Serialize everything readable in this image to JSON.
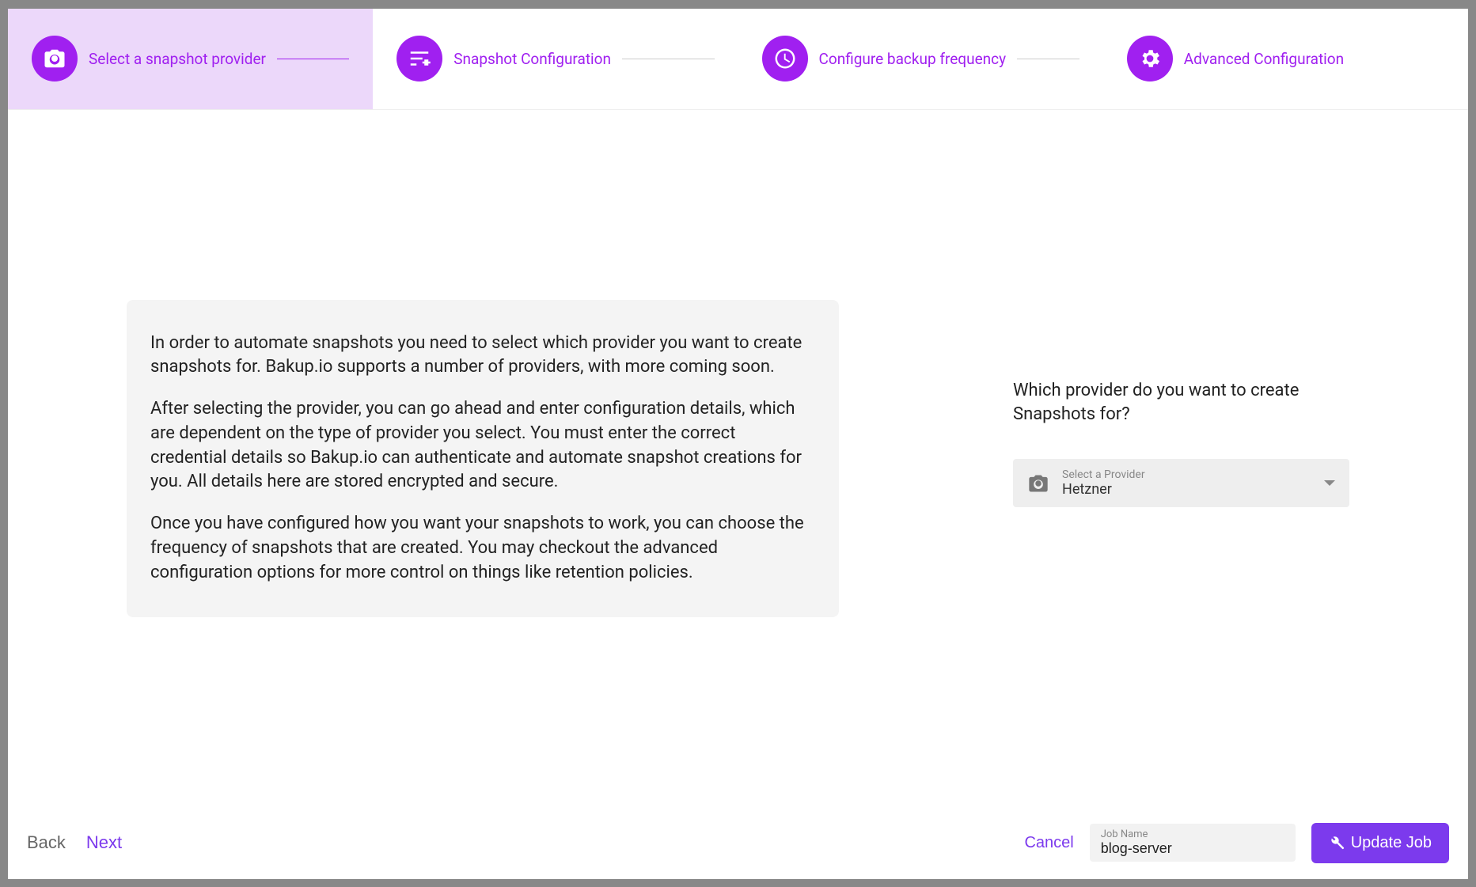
{
  "stepper": {
    "steps": [
      {
        "label": "Select a snapshot provider"
      },
      {
        "label": "Snapshot Configuration"
      },
      {
        "label": "Configure backup frequency"
      },
      {
        "label": "Advanced Configuration"
      }
    ]
  },
  "info": {
    "p1": "In order to automate snapshots you need to select which provider you want to create snapshots for. Bakup.io supports a number of providers, with more coming soon.",
    "p2": "After selecting the provider, you can go ahead and enter configuration details, which are dependent on the type of provider you select. You must enter the correct credential details so Bakup.io can authenticate and automate snapshot creations for you. All details here are stored encrypted and secure.",
    "p3": "Once you have configured how you want your snapshots to work, you can choose the frequency of snapshots that are created. You may checkout the advanced configuration options for more control on things like retention policies."
  },
  "providerSelect": {
    "question": "Which provider do you want to create Snapshots for?",
    "placeholder": "Select a Provider",
    "value": "Hetzner"
  },
  "footer": {
    "back": "Back",
    "next": "Next",
    "cancel": "Cancel",
    "jobname_label": "Job Name",
    "jobname_value": "blog-server",
    "update": "Update Job"
  }
}
